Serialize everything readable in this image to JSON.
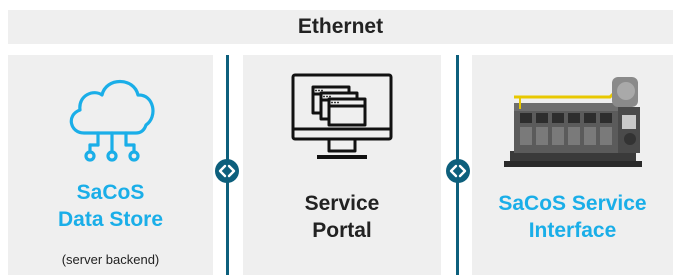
{
  "header": {
    "title": "Ethernet"
  },
  "panels": {
    "data_store": {
      "title_line1": "SaCoS",
      "title_line2": "Data Store",
      "subtitle": "(server backend)",
      "icon": "cloud-network-icon"
    },
    "service_portal": {
      "title_line1": "Service",
      "title_line2": "Portal",
      "icon": "monitor-windows-icon"
    },
    "service_interface": {
      "title_line1": "SaCoS Service",
      "title_line2": "Interface",
      "icon": "engine-photo"
    }
  },
  "connectors": [
    "bidirectional-arrow-icon",
    "bidirectional-arrow-icon"
  ],
  "colors": {
    "accent_blue": "#1aaee8",
    "line_teal": "#0d5f7c",
    "panel_bg": "#efefef",
    "text_dark": "#222222"
  }
}
